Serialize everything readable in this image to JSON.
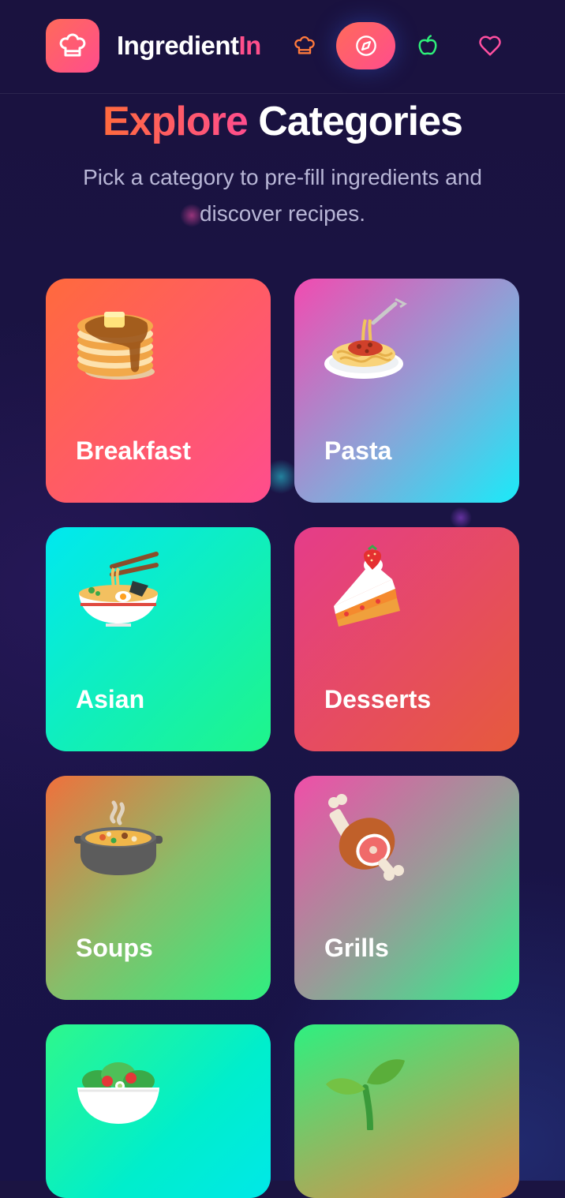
{
  "header": {
    "app_name_main": "Ingredient",
    "app_name_accent": "In",
    "nav": {
      "recipes_icon": "chef-hat-icon",
      "explore_icon": "compass-icon",
      "pantry_icon": "apple-icon",
      "favorites_icon": "heart-icon",
      "active": "explore"
    }
  },
  "hero": {
    "title_accent": "Explore",
    "title_rest": " Categories",
    "subtitle": "Pick a category to pre-fill ingredients and discover recipes."
  },
  "categories": [
    {
      "label": "Breakfast",
      "icon": "pancakes-icon"
    },
    {
      "label": "Pasta",
      "icon": "spaghetti-icon"
    },
    {
      "label": "Asian",
      "icon": "ramen-icon"
    },
    {
      "label": "Desserts",
      "icon": "cake-icon"
    },
    {
      "label": "Soups",
      "icon": "soup-pot-icon"
    },
    {
      "label": "Grills",
      "icon": "meat-on-bone-icon"
    },
    {
      "label": "",
      "icon": "salad-icon"
    },
    {
      "label": "",
      "icon": "seedling-icon"
    }
  ],
  "colors": {
    "background": "#1b1442",
    "accent_orange": "#ff6a3d",
    "accent_pink": "#ff4d8d",
    "subtitle_text": "#b8b6d6"
  }
}
